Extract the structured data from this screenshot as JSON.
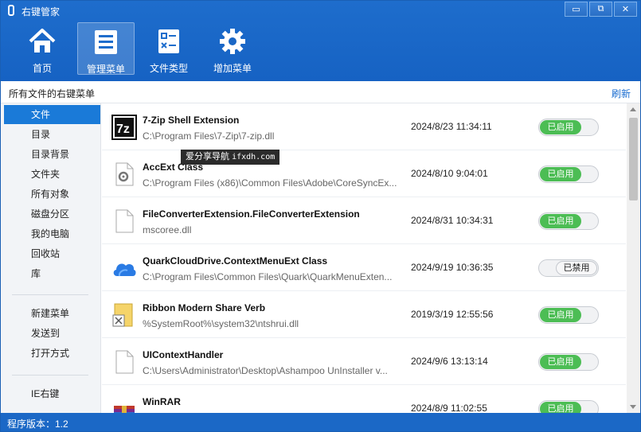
{
  "window": {
    "title": "右键管家",
    "buttons": [
      "▭",
      "⧉",
      "✕"
    ]
  },
  "toolbar": {
    "items": [
      {
        "label": "首页",
        "icon": "home-icon"
      },
      {
        "label": "管理菜单",
        "icon": "menu-list-icon",
        "active": true
      },
      {
        "label": "文件类型",
        "icon": "file-type-icon"
      },
      {
        "label": "增加菜单",
        "icon": "gear-icon"
      }
    ]
  },
  "subheader": {
    "title": "所有文件的右键菜单",
    "refresh": "刷新"
  },
  "sidebar": {
    "items": [
      "文件",
      "目录",
      "目录背景",
      "文件夹",
      "所有对象",
      "磁盘分区",
      "我的电脑",
      "回收站",
      "库"
    ],
    "items2": [
      "新建菜单",
      "发送到",
      "打开方式"
    ],
    "items3": [
      "IE右键"
    ]
  },
  "entries": [
    {
      "name": "7-Zip Shell Extension",
      "path": "C:\\Program Files\\7-Zip\\7-zip.dll",
      "time": "2024/8/23 11:34:11",
      "status": "已启用",
      "enabled": true,
      "icon": "7zip-icon"
    },
    {
      "name": "AccExt Class",
      "path": "C:\\Program Files (x86)\\Common Files\\Adobe\\CoreSyncEx...",
      "time": "2024/8/10 9:04:01",
      "status": "已启用",
      "enabled": true,
      "icon": "settings-file-icon"
    },
    {
      "name": "FileConverterExtension.FileConverterExtension",
      "path": "mscoree.dll",
      "time": "2024/8/31 10:34:31",
      "status": "已启用",
      "enabled": true,
      "icon": "blank-file-icon"
    },
    {
      "name": "QuarkCloudDrive.ContextMenuExt Class",
      "path": "C:\\Program Files\\Common Files\\Quark\\QuarkMenuExten...",
      "time": "2024/9/19 10:36:35",
      "status": "已禁用",
      "enabled": false,
      "icon": "cloud-icon"
    },
    {
      "name": "Ribbon Modern Share Verb",
      "path": "%SystemRoot%\\system32\\ntshrui.dll",
      "time": "2019/3/19 12:55:56",
      "status": "已启用",
      "enabled": true,
      "icon": "share-folder-icon"
    },
    {
      "name": "UIContextHandler",
      "path": "C:\\Users\\Administrator\\Desktop\\Ashampoo UnInstaller v...",
      "time": "2024/9/6 13:13:14",
      "status": "已启用",
      "enabled": true,
      "icon": "blank-file-icon"
    },
    {
      "name": "WinRAR",
      "path": "",
      "time": "2024/8/9 11:02:55",
      "status": "已启用",
      "enabled": true,
      "icon": "winrar-icon"
    }
  ],
  "tooltip": {
    "text": "爱分享导航",
    "url": "ifxdh.com"
  },
  "status": {
    "version": "程序版本：1.2"
  },
  "colors": {
    "accent": "#1a6dd0",
    "enabled": "#4cbd54",
    "selected": "#1a7ad8"
  }
}
